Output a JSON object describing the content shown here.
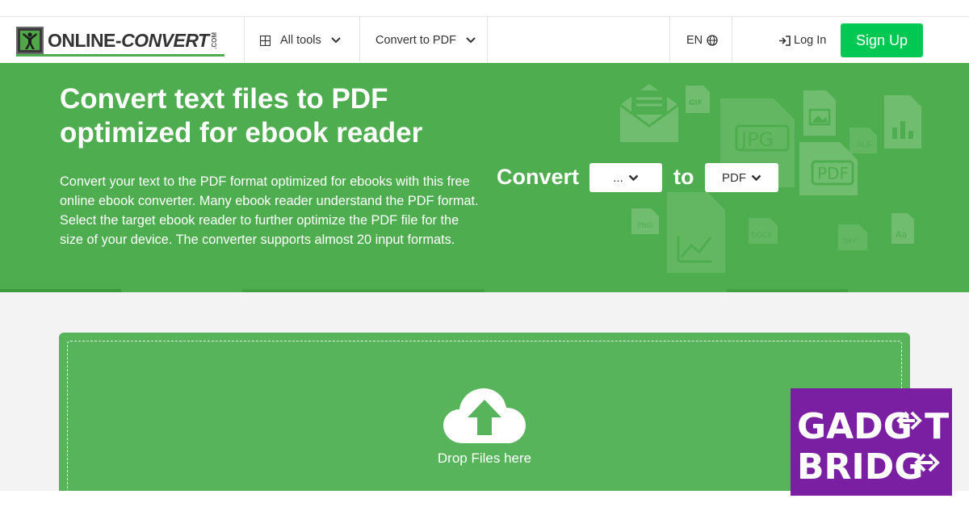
{
  "header": {
    "logo_main": "ONLINE-",
    "logo_accent": "CONVERT",
    "logo_suffix": ".COM",
    "all_tools_label": "All tools",
    "convert_to_pdf_label": "Convert to PDF",
    "language_label": "EN",
    "login_label": "Log In",
    "signup_label": "Sign Up"
  },
  "hero": {
    "title": "Convert text files to PDF optimized for ebook reader",
    "description": "Convert your text to the PDF format optimized for ebooks with this free online ebook converter. Many ebook reader understand the PDF format. Select the target ebook reader to further optimize the PDF file for the size of your device. The converter supports almost 20 input formats.",
    "convert_label": "Convert",
    "to_label": "to",
    "source_select_value": "...",
    "target_select_value": "PDF",
    "bg_file_labels": [
      "GIF",
      "JPG",
      "XLS",
      "PDF",
      "PNG",
      "DOCX",
      "TIFF"
    ]
  },
  "dropzone": {
    "label": "Drop Files here"
  },
  "watermark": {
    "line1": "GADG T",
    "line2": "BRIDG"
  },
  "colors": {
    "hero_green": "#4eae4f",
    "dropzone_green": "#57b45a",
    "signup_green": "#00c853",
    "watermark_purple": "#7b1fa2"
  },
  "icons": [
    "grid-icon",
    "chevron-down-icon",
    "globe-icon",
    "login-arrow-icon",
    "cloud-upload-icon"
  ]
}
